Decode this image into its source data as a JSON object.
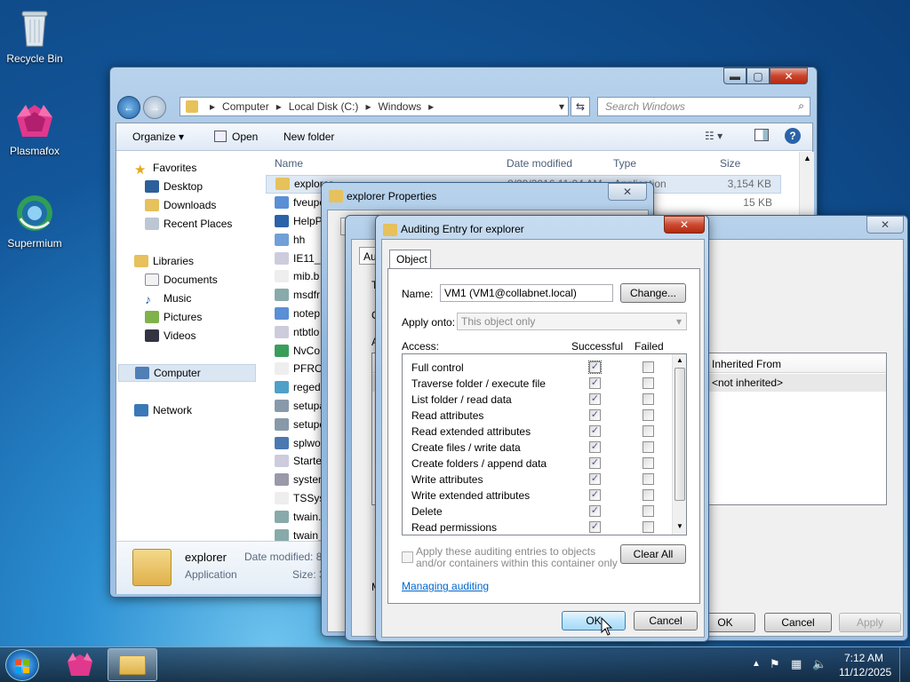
{
  "desktop": {
    "icons": [
      {
        "label": "Recycle Bin"
      },
      {
        "label": "Plasmafox"
      },
      {
        "label": "Supermium"
      }
    ]
  },
  "explorer": {
    "breadcrumb": [
      "Computer",
      "Local Disk (C:)",
      "Windows"
    ],
    "search_placeholder": "Search Windows",
    "toolbar": {
      "organize": "Organize ▾",
      "open": "Open",
      "new_folder": "New folder"
    },
    "nav": {
      "favorites": "Favorites",
      "desktop": "Desktop",
      "downloads": "Downloads",
      "recent": "Recent Places",
      "libraries": "Libraries",
      "documents": "Documents",
      "music": "Music",
      "pictures": "Pictures",
      "videos": "Videos",
      "computer": "Computer",
      "network": "Network"
    },
    "columns": {
      "name": "Name",
      "date": "Date modified",
      "type": "Type",
      "size": "Size"
    },
    "files": [
      {
        "name": "explorer",
        "date": "8/29/2016 11:04 AM",
        "type": "Application",
        "size": "3,154 KB"
      },
      {
        "name": "fveupo",
        "date": "",
        "type": "ation",
        "size": "15 KB"
      },
      {
        "name": "HelpP",
        "date": "",
        "type": "",
        "size": ""
      },
      {
        "name": "hh",
        "date": "",
        "type": "",
        "size": ""
      },
      {
        "name": "IE11_m",
        "date": "",
        "type": "",
        "size": ""
      },
      {
        "name": "mib.b",
        "date": "",
        "type": "",
        "size": ""
      },
      {
        "name": "msdfr",
        "date": "",
        "type": "",
        "size": ""
      },
      {
        "name": "notep",
        "date": "",
        "type": "",
        "size": ""
      },
      {
        "name": "ntbtlo",
        "date": "",
        "type": "",
        "size": ""
      },
      {
        "name": "NvCo",
        "date": "",
        "type": "",
        "size": ""
      },
      {
        "name": "PFRO",
        "date": "",
        "type": "",
        "size": ""
      },
      {
        "name": "regedi",
        "date": "",
        "type": "",
        "size": ""
      },
      {
        "name": "setupa",
        "date": "",
        "type": "",
        "size": ""
      },
      {
        "name": "setupe",
        "date": "",
        "type": "",
        "size": ""
      },
      {
        "name": "splwo",
        "date": "",
        "type": "",
        "size": ""
      },
      {
        "name": "Starte",
        "date": "",
        "type": "",
        "size": ""
      },
      {
        "name": "systen",
        "date": "",
        "type": "",
        "size": ""
      },
      {
        "name": "TSSys",
        "date": "",
        "type": "",
        "size": ""
      },
      {
        "name": "twain.",
        "date": "",
        "type": "",
        "size": ""
      },
      {
        "name": "twain_",
        "date": "",
        "type": "",
        "size": ""
      }
    ],
    "details": {
      "name": "explorer",
      "type": "Application",
      "date_label": "Date modified:  8",
      "size_label": "Size:  3"
    }
  },
  "props": {
    "title": "explorer Properties",
    "tab_fragment": "G"
  },
  "advanced": {
    "tab_fragment": "Au",
    "col_inherited": "Inherited From",
    "inherited_value": "<not inherited>",
    "frag_t": "T",
    "frag_o": "O",
    "frag_a": "A",
    "frag_m": "M",
    "ok": "OK",
    "cancel": "Cancel",
    "apply": "Apply"
  },
  "audit": {
    "title": "Auditing Entry for explorer",
    "tab": "Object",
    "name_label": "Name:",
    "name_value": "VM1 (VM1@collabnet.local)",
    "change": "Change...",
    "apply_label": "Apply onto:",
    "apply_value": "This object only",
    "access_label": "Access:",
    "col_success": "Successful",
    "col_failed": "Failed",
    "rows": [
      {
        "label": "Full control"
      },
      {
        "label": "Traverse folder / execute file"
      },
      {
        "label": "List folder / read data"
      },
      {
        "label": "Read attributes"
      },
      {
        "label": "Read extended attributes"
      },
      {
        "label": "Create files / write data"
      },
      {
        "label": "Create folders / append data"
      },
      {
        "label": "Write attributes"
      },
      {
        "label": "Write extended attributes"
      },
      {
        "label": "Delete"
      },
      {
        "label": "Read permissions"
      }
    ],
    "apply_check": "Apply these auditing entries to objects\nand/or containers within this container only",
    "clear_all": "Clear All",
    "link": "Managing auditing",
    "ok": "OK",
    "cancel": "Cancel"
  },
  "taskbar": {
    "time": "7:12 AM",
    "date": "11/12/2025"
  }
}
